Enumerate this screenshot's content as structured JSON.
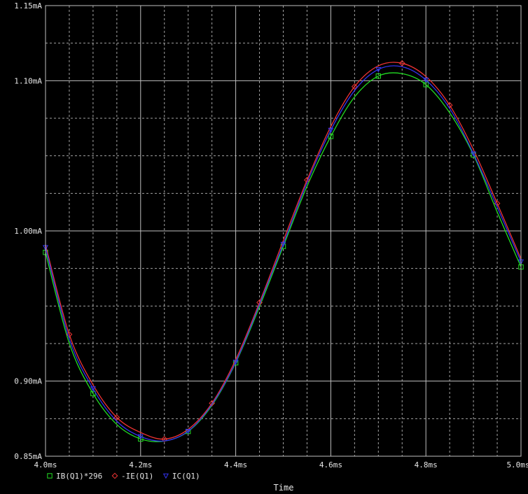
{
  "chart_data": {
    "type": "line",
    "title": "",
    "xlabel": "Time",
    "ylabel": "",
    "xlim": [
      4.0,
      5.0
    ],
    "ylim": [
      0.85,
      1.15
    ],
    "grid": true,
    "background": "#000000",
    "grid_color": "#bfbfbf",
    "x_ticks": [
      {
        "value": 4.0,
        "label": "4.0ms"
      },
      {
        "value": 4.2,
        "label": "4.2ms"
      },
      {
        "value": 4.4,
        "label": "4.4ms"
      },
      {
        "value": 4.6,
        "label": "4.6ms"
      },
      {
        "value": 4.8,
        "label": "4.8ms"
      },
      {
        "value": 5.0,
        "label": "5.0ms"
      }
    ],
    "y_ticks": [
      {
        "value": 0.85,
        "label": "0.85mA"
      },
      {
        "value": 0.9,
        "label": "0.90mA"
      },
      {
        "value": 1.0,
        "label": "1.00mA"
      },
      {
        "value": 1.1,
        "label": "1.10mA"
      },
      {
        "value": 1.15,
        "label": "1.15mA"
      }
    ],
    "legend_position": "bottom-left",
    "series": [
      {
        "name": "IB(Q1)*296",
        "color": "#22dd22",
        "marker": "square",
        "x": [
          4.0,
          4.05,
          4.1,
          4.15,
          4.2,
          4.25,
          4.3,
          4.35,
          4.4,
          4.45,
          4.5,
          4.55,
          4.6,
          4.65,
          4.7,
          4.75,
          4.8,
          4.85,
          4.9,
          4.95,
          5.0
        ],
        "y": [
          0.9857,
          0.9252,
          0.8917,
          0.8711,
          0.8615,
          0.8601,
          0.8665,
          0.8839,
          0.9122,
          0.9495,
          0.9897,
          1.0297,
          1.0629,
          1.0892,
          1.1031,
          1.1047,
          1.0974,
          1.0786,
          1.0506,
          1.0125,
          0.976
        ]
      },
      {
        "name": "-IE(Q1)",
        "color": "#ee3333",
        "marker": "diamond",
        "x": [
          4.0,
          4.05,
          4.1,
          4.15,
          4.2,
          4.25,
          4.3,
          4.35,
          4.4,
          4.45,
          4.5,
          4.55,
          4.6,
          4.65,
          4.7,
          4.75,
          4.8,
          4.85,
          4.9,
          4.95,
          5.0
        ],
        "y": [
          0.9908,
          0.9311,
          0.8975,
          0.8758,
          0.8658,
          0.8614,
          0.8679,
          0.8853,
          0.9143,
          0.9523,
          0.9935,
          1.0339,
          1.0695,
          1.0961,
          1.1099,
          1.1116,
          1.1028,
          1.0837,
          1.0541,
          1.0183,
          0.9814
        ]
      },
      {
        "name": "IC(Q1)",
        "color": "#3333ee",
        "marker": "triangle-down",
        "x": [
          4.0,
          4.05,
          4.1,
          4.15,
          4.2,
          4.25,
          4.3,
          4.35,
          4.4,
          4.45,
          4.5,
          4.55,
          4.6,
          4.65,
          4.7,
          4.75,
          4.8,
          4.85,
          4.9,
          4.95,
          5.0
        ],
        "y": [
          0.989,
          0.9281,
          0.895,
          0.8733,
          0.8631,
          0.8602,
          0.8667,
          0.8845,
          0.9127,
          0.951,
          0.9912,
          1.0321,
          1.0671,
          1.0935,
          1.1075,
          1.1093,
          1.1005,
          1.0815,
          1.0514,
          1.0158,
          0.9795
        ]
      }
    ]
  }
}
